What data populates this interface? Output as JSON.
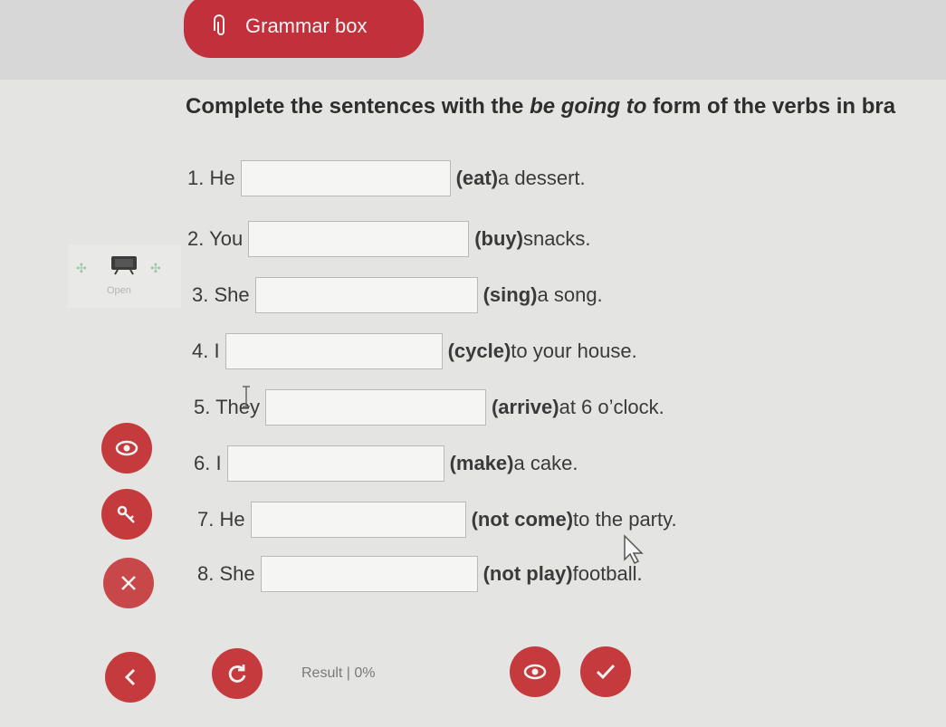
{
  "header": {
    "grammar_box_label": "Grammar box"
  },
  "instruction": {
    "part1": "Complete the sentences with the ",
    "part_italic": "be going to",
    "part2": " form of the verbs in bra"
  },
  "sentences": [
    {
      "subject": "1. He",
      "verb": "(eat)",
      "rest": " a dessert.",
      "answer": ""
    },
    {
      "subject": "2. You",
      "verb": "(buy)",
      "rest": " snacks.",
      "answer": ""
    },
    {
      "subject": "3. She",
      "verb": "(sing)",
      "rest": " a song.",
      "answer": ""
    },
    {
      "subject": "4. I",
      "verb": "(cycle)",
      "rest": " to your house.",
      "answer": ""
    },
    {
      "subject": "5. They",
      "verb": "(arrive)",
      "rest": " at 6 o’clock.",
      "answer": ""
    },
    {
      "subject": "6. I",
      "verb": "(make)",
      "rest": " a cake.",
      "answer": ""
    },
    {
      "subject": "7. He",
      "verb": "(not come)",
      "rest": " to the party.",
      "answer": ""
    },
    {
      "subject": "8. She",
      "verb": "(not play)",
      "rest": " football.",
      "answer": ""
    }
  ],
  "toolbar": {
    "open_label": "Open"
  },
  "footer": {
    "result_label": "Result | 0%"
  },
  "icons": {
    "paperclip": "paperclip-icon",
    "board": "whiteboard-icon",
    "eye": "eye-icon",
    "key": "key-icon",
    "close": "close-icon",
    "back": "chevron-left-icon",
    "reset": "reset-icon",
    "check": "check-icon"
  },
  "colors": {
    "accent": "#c53a3c",
    "background": "#e4e4e2"
  }
}
